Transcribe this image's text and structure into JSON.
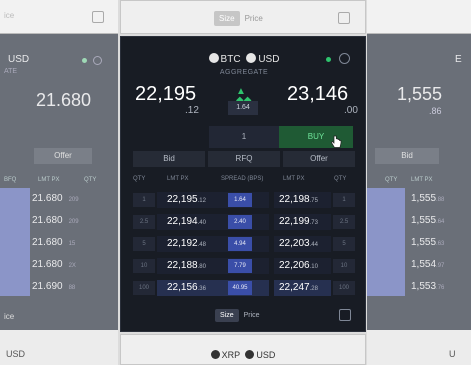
{
  "left_panel": {
    "top_label": "ice",
    "ccy_label": "USD",
    "sub_label": "ATE",
    "big_price": "21.680",
    "offer_label": "Offer",
    "hdr_bfq": "BFQ",
    "hdr_lmt": "LMT PX",
    "hdr_qty": "QTY",
    "rows": [
      {
        "px": "21.680",
        "q": "209"
      },
      {
        "px": "21.680",
        "q": "209"
      },
      {
        "px": "21.680",
        "q": "15"
      },
      {
        "px": "21.680",
        "q": "2X"
      },
      {
        "px": "21.690",
        "q": "88"
      }
    ],
    "bottom_label": "ice",
    "bottom_ccy": "USD"
  },
  "right_panel": {
    "ccy_label": "E",
    "big_price": "1,555",
    "small_price": ".86",
    "bid_label": "Bid",
    "hdr_qty": "QTY",
    "hdr_lmt": "LMT PX",
    "rows": [
      {
        "px": "1,555",
        "small": ".88"
      },
      {
        "px": "1,555",
        "small": ".64"
      },
      {
        "px": "1,555",
        "small": ".63"
      },
      {
        "px": "1,554",
        "small": ".97"
      },
      {
        "px": "1,553",
        "small": ".76"
      }
    ],
    "bottom_ccy": "U"
  },
  "center": {
    "toggle": {
      "size": "Size",
      "price": "Price"
    },
    "pair": {
      "base": "BTC",
      "quote": "USD"
    },
    "aggregate": "AGGREGATE",
    "bid_big": "22,195",
    "bid_small": ".12",
    "ask_big": "23,146",
    "ask_small": ".00",
    "spread_value": "1.64",
    "qty_value": "1",
    "buy_label": "BUY",
    "bid_label": "Bid",
    "rfq_label": "RFQ",
    "offer_label": "Offer",
    "headers": {
      "qty_l": "QTY",
      "lmt_l": "LMT PX",
      "spread": "SPREAD (BPS)",
      "lmt_r": "LMT PX",
      "qty_r": "QTY"
    },
    "ladder": [
      {
        "ql": "1",
        "bid": "22,195",
        "bid_s": ".12",
        "spr": "1.64",
        "ask": "22,198",
        "ask_s": ".75",
        "qr": "1"
      },
      {
        "ql": "2.5",
        "bid": "22,194",
        "bid_s": ".40",
        "spr": "2.40",
        "ask": "22,199",
        "ask_s": ".73",
        "qr": "2.5"
      },
      {
        "ql": "5",
        "bid": "22,192",
        "bid_s": ".48",
        "spr": "4.94",
        "ask": "22,203",
        "ask_s": ".44",
        "qr": "5"
      },
      {
        "ql": "10",
        "bid": "22,188",
        "bid_s": ".80",
        "spr": "7.79",
        "ask": "22,206",
        "ask_s": ".10",
        "qr": "10"
      },
      {
        "ql": "100",
        "bid": "22,156",
        "bid_s": ".36",
        "spr": "40.95",
        "ask": "22,247",
        "ask_s": ".28",
        "qr": "100"
      }
    ],
    "bottom_pair": {
      "base": "XRP",
      "quote": "USD"
    }
  },
  "colors": {
    "panel_bg": "#181c24",
    "accent_green": "#2ec46d",
    "buy_bg": "#1f5a34",
    "spread_blue": "#3a4ea8"
  }
}
